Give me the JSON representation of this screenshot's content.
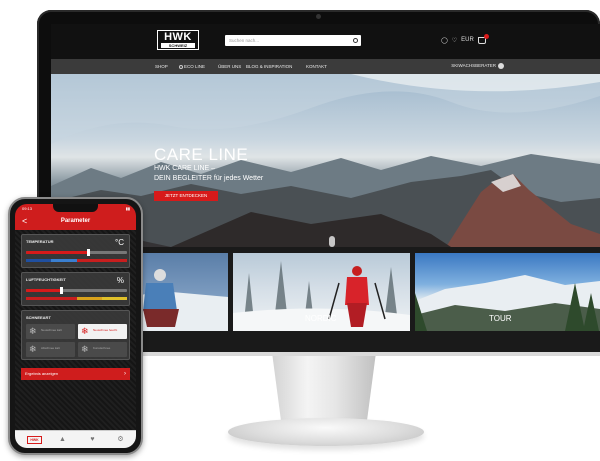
{
  "site": {
    "logo_text": "HWK",
    "logo_subtext": "SCHWEIZ",
    "search_placeholder": "Suchen nach...",
    "cart_label": "EUR",
    "nav": [
      "SHOP",
      "ECO LINE",
      "ÜBER UNS",
      "BLOG & INSPIRATION",
      "KONTAKT"
    ],
    "wax_advisor": "SKIWACHSBERATER",
    "hero": {
      "title": "CARE LINE",
      "subtitle_line1": "HWK CARE LINE –",
      "subtitle_line2": "DEIN BEGLEITER für jedes Wetter",
      "button": "JETZT ENTDECKEN"
    },
    "tiles": [
      "",
      "NORDIC",
      "TOUR"
    ]
  },
  "app": {
    "status_time": "09:13",
    "title": "Parameter",
    "back": "<",
    "temperature": {
      "label": "TEMPERATUR",
      "unit": "°C",
      "value_fraction": 0.62
    },
    "humidity": {
      "label": "LUFTFEUCHTIGKEIT",
      "unit": "%",
      "value_fraction": 0.35
    },
    "snow": {
      "label": "SCHNEEART",
      "options": [
        {
          "label": "Neuschnee kalt",
          "active": false
        },
        {
          "label": "Neuschnee feucht",
          "active": true
        },
        {
          "label": "Altschnee kalt",
          "active": false
        },
        {
          "label": "Kunstschnee",
          "active": false
        }
      ]
    },
    "result_button": "Ergebnis anzeigen",
    "tab_logo": "HWK",
    "tabs": [
      "shoe-icon",
      "heart-icon",
      "gear-icon"
    ]
  },
  "colors": {
    "accent": "#d71a1a",
    "nav_bg": "#3b3b3b",
    "header_bg": "#111111"
  }
}
